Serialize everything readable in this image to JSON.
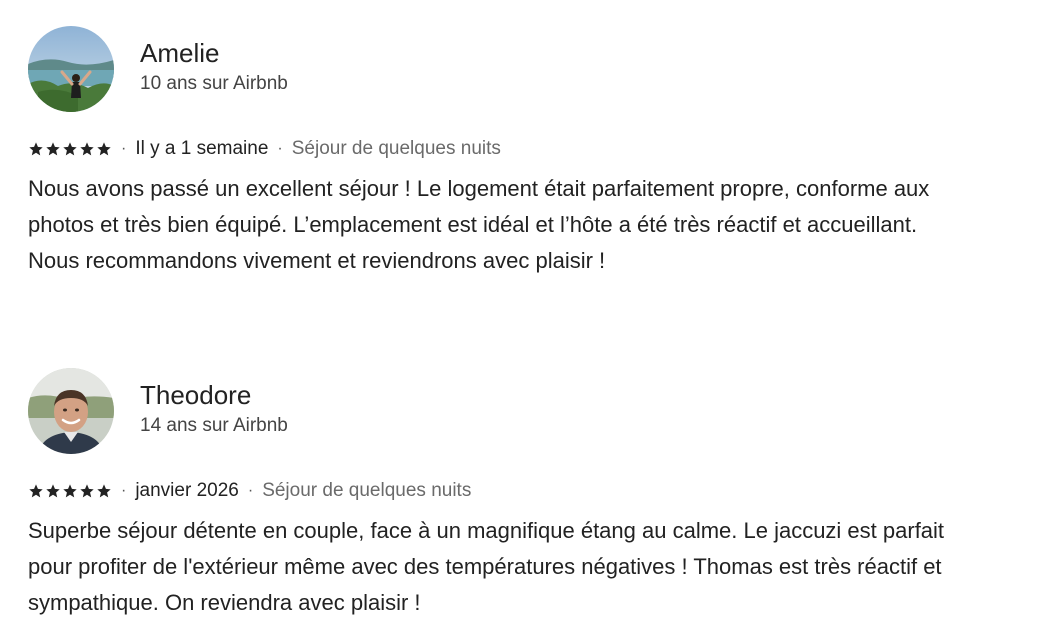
{
  "reviews": [
    {
      "name": "Amelie",
      "tenure": "10 ans sur Airbnb",
      "rating": 5,
      "date": "Il y a 1 semaine",
      "stay": "Séjour de quelques nuits",
      "text": "Nous avons passé un excellent séjour ! Le logement était parfaitement propre, conforme aux photos et très bien équipé. L’emplacement est idéal et l’hôte a été très réactif et accueillant. Nous recommandons vivement et reviendrons avec plaisir !"
    },
    {
      "name": "Theodore",
      "tenure": "14 ans sur Airbnb",
      "rating": 5,
      "date": "janvier 2026",
      "stay": "Séjour de quelques nuits",
      "text": "Superbe séjour détente en couple, face à un magnifique étang au calme. Le jaccuzi est parfait pour profiter de l'extérieur même avec des températures négatives ! Thomas est très réactif et sympathique. On reviendra avec plaisir !"
    }
  ],
  "separator": "·",
  "colors": {
    "text": "#222222",
    "muted": "#6a6a6a",
    "star": "#222222"
  }
}
